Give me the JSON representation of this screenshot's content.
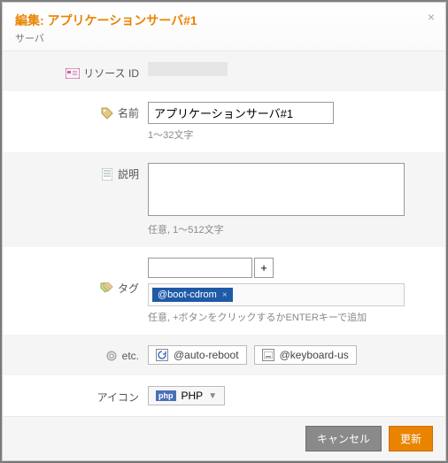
{
  "header": {
    "title": "編集: アプリケーションサーバ#1",
    "subtitle": "サーバ"
  },
  "labels": {
    "resource_id": "リソース ID",
    "name": "名前",
    "description": "説明",
    "tags": "タグ",
    "etc": "etc.",
    "icon": "アイコン"
  },
  "fields": {
    "resource_id_value": "",
    "name_value": "アプリケーションサーバ#1",
    "name_hint": "1〜32文字",
    "description_value": "",
    "description_hint": "任意, 1〜512文字",
    "tag_input_value": "",
    "tag_add_label": "+",
    "tags": [
      "@boot-cdrom"
    ],
    "tags_hint": "任意, +ボタンをクリックするかENTERキーで追加",
    "etc_options": [
      {
        "icon": "reload",
        "label": "@auto-reboot"
      },
      {
        "icon": "keyboard",
        "label": "@keyboard-us"
      }
    ],
    "icon_select": {
      "badge": "php",
      "label": "PHP"
    }
  },
  "footer": {
    "cancel": "キャンセル",
    "submit": "更新"
  }
}
